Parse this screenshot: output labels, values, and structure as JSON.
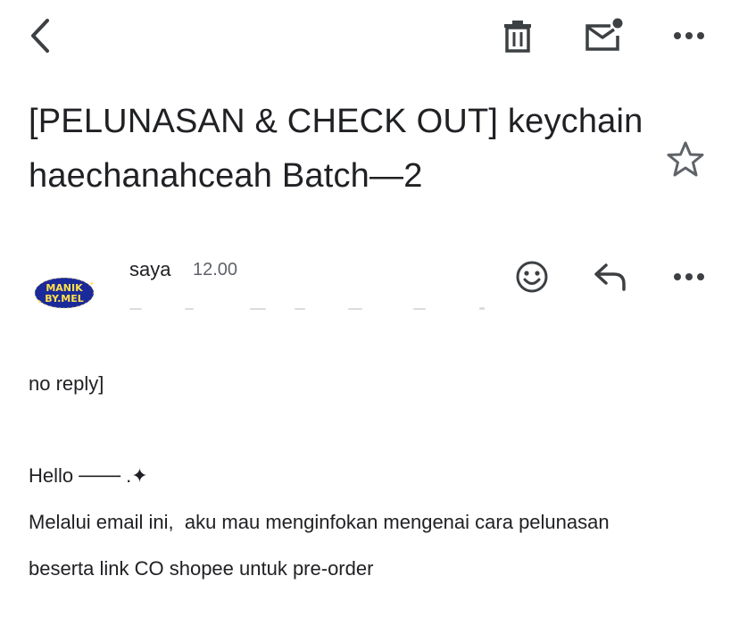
{
  "toolbar": {
    "back_icon": "arrow-left-icon",
    "delete_icon": "trash-icon",
    "mark_unread_icon": "mail-unread-icon",
    "more_icon": "more-horizontal-icon"
  },
  "email": {
    "subject": "[PELUNASAN & CHECK OUT] keychain haechanahceah Batch—2",
    "starred": false,
    "sender": {
      "name": "saya",
      "time": "12.00",
      "avatar_text_line1": "MANIK",
      "avatar_text_line2": "BY.MEL"
    },
    "actions": {
      "emoji_icon": "smiley-icon",
      "reply_icon": "reply-icon",
      "more_icon": "more-horizontal-icon"
    },
    "body": {
      "line1": "no reply]",
      "line2": "Hello ─── .✦",
      "line3": "Melalui email ini,  aku mau menginfokan mengenai cara pelunasan",
      "line4": "beserta link CO shopee untuk pre-order"
    }
  },
  "colors": {
    "icon": "#3c4043",
    "text": "#202124",
    "muted": "#5f6368",
    "avatar_bg": "#1b2a9a",
    "avatar_text": "#ffe14a"
  }
}
